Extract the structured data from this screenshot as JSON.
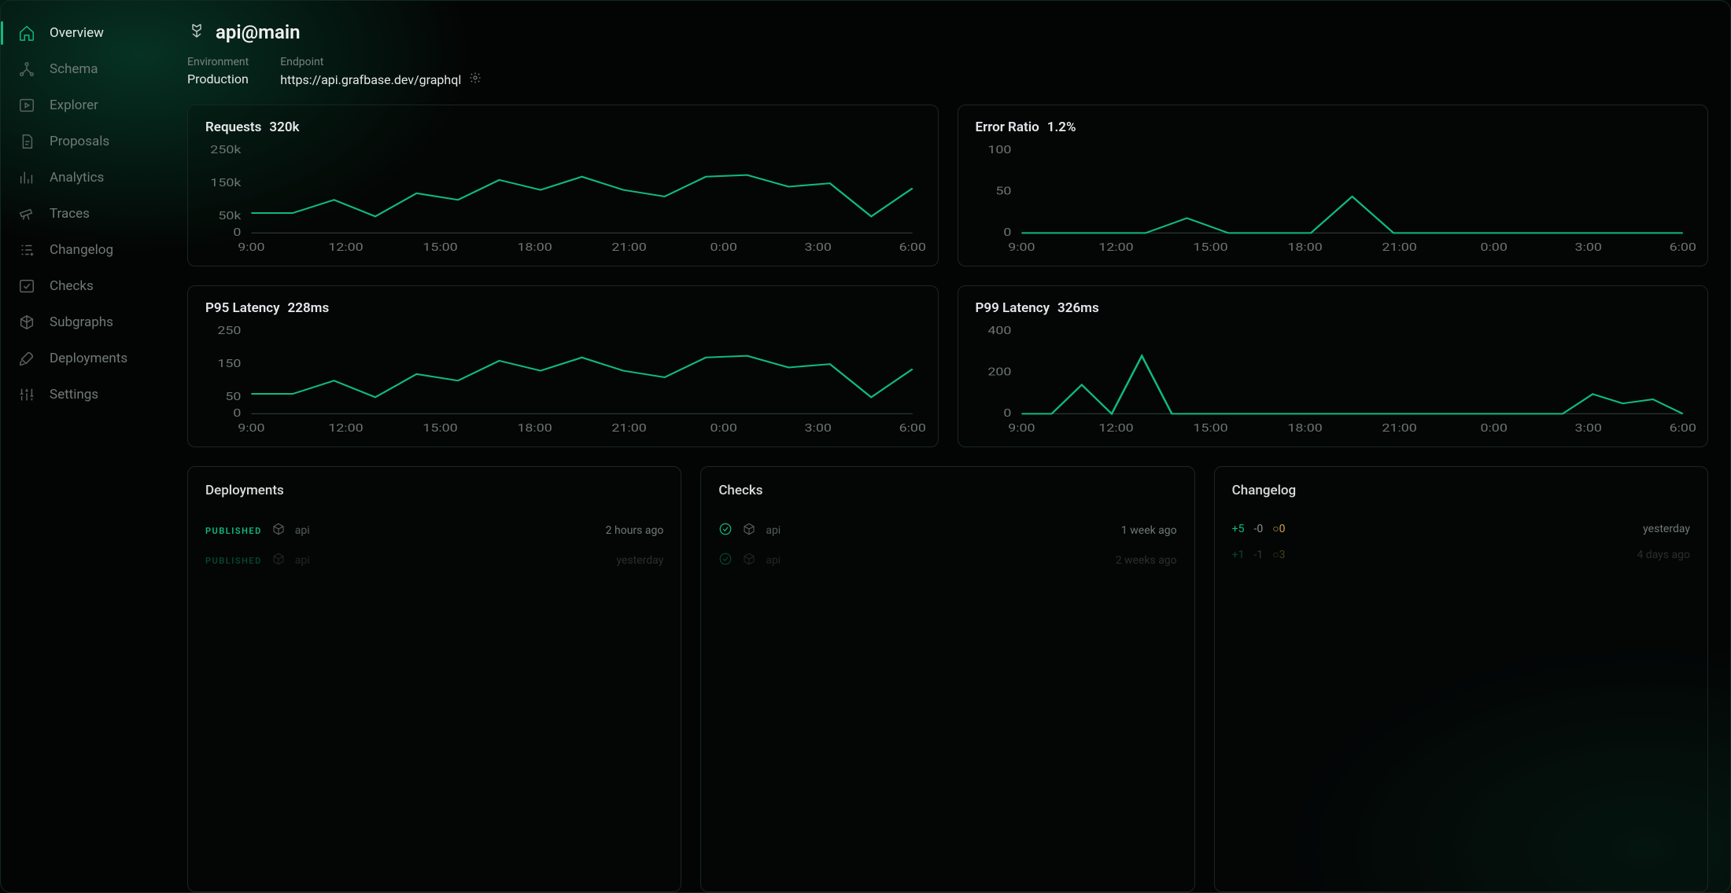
{
  "sidebar": {
    "items": [
      {
        "label": "Overview"
      },
      {
        "label": "Schema"
      },
      {
        "label": "Explorer"
      },
      {
        "label": "Proposals"
      },
      {
        "label": "Analytics"
      },
      {
        "label": "Traces"
      },
      {
        "label": "Changelog"
      },
      {
        "label": "Checks"
      },
      {
        "label": "Subgraphs"
      },
      {
        "label": "Deployments"
      },
      {
        "label": "Settings"
      }
    ]
  },
  "header": {
    "title": "api@main",
    "env_label": "Environment",
    "env_value": "Production",
    "endpoint_label": "Endpoint",
    "endpoint_value": "https://api.grafbase.dev/graphql"
  },
  "cards": {
    "requests": {
      "title": "Requests",
      "value": "320k"
    },
    "errors": {
      "title": "Error Ratio",
      "value": "1.2%"
    },
    "p95": {
      "title": "P95 Latency",
      "value": "228ms"
    },
    "p99": {
      "title": "P99 Latency",
      "value": "326ms"
    }
  },
  "bottom": {
    "deployments": {
      "title": "Deployments",
      "rows": [
        {
          "badge": "PUBLISHED",
          "name": "api",
          "time": "2 hours ago"
        },
        {
          "badge": "PUBLISHED",
          "name": "api",
          "time": "yesterday"
        }
      ]
    },
    "checks": {
      "title": "Checks",
      "rows": [
        {
          "name": "api",
          "time": "1 week ago"
        },
        {
          "name": "api",
          "time": "2 weeks ago"
        }
      ]
    },
    "changelog": {
      "title": "Changelog",
      "rows": [
        {
          "plus": "+5",
          "minus": "-0",
          "ring": "○0",
          "time": "yesterday"
        },
        {
          "plus": "+1",
          "minus": "-1",
          "ring": "○3",
          "time": "4 days ago"
        }
      ]
    }
  },
  "chart_data": [
    {
      "id": "requests",
      "type": "line",
      "title": "Requests 320k",
      "ylabel": "",
      "xlabel": "",
      "ylim": [
        0,
        250000
      ],
      "yticks": [
        0,
        50000,
        150000,
        250000
      ],
      "ytick_labels": [
        "0",
        "50k",
        "150k",
        "250k"
      ],
      "xticks": [
        "9:00",
        "12:00",
        "15:00",
        "18:00",
        "21:00",
        "0:00",
        "3:00",
        "6:00"
      ],
      "x": [
        0,
        1,
        2,
        3,
        4,
        5,
        6,
        7,
        8,
        9,
        10,
        11,
        12,
        13,
        14,
        15
      ],
      "values": [
        60000,
        60000,
        100000,
        50000,
        120000,
        100000,
        160000,
        130000,
        170000,
        130000,
        110000,
        170000,
        175000,
        140000,
        150000,
        50000,
        135000
      ]
    },
    {
      "id": "errors",
      "type": "line",
      "title": "Error Ratio 1.2%",
      "ylim": [
        0,
        100
      ],
      "yticks": [
        0,
        50,
        100
      ],
      "ytick_labels": [
        "0",
        "50",
        "100"
      ],
      "xticks": [
        "9:00",
        "12:00",
        "15:00",
        "18:00",
        "21:00",
        "0:00",
        "3:00",
        "6:00"
      ],
      "x": [
        0,
        1,
        2,
        3,
        4,
        5,
        6,
        7,
        8,
        9,
        10,
        11,
        12,
        13,
        14,
        15,
        16
      ],
      "values": [
        0,
        0,
        0,
        0,
        18,
        0,
        0,
        0,
        44,
        0,
        0,
        0,
        0,
        0,
        0,
        0,
        0
      ]
    },
    {
      "id": "p95",
      "type": "line",
      "title": "P95 Latency 228ms",
      "ylim": [
        0,
        250
      ],
      "yticks": [
        0,
        50,
        150,
        250
      ],
      "ytick_labels": [
        "0",
        "50",
        "150",
        "250"
      ],
      "xticks": [
        "9:00",
        "12:00",
        "15:00",
        "18:00",
        "21:00",
        "0:00",
        "3:00",
        "6:00"
      ],
      "x": [
        0,
        1,
        2,
        3,
        4,
        5,
        6,
        7,
        8,
        9,
        10,
        11,
        12,
        13,
        14,
        15
      ],
      "values": [
        60,
        60,
        100,
        50,
        120,
        100,
        160,
        130,
        170,
        130,
        110,
        170,
        175,
        140,
        150,
        50,
        135
      ]
    },
    {
      "id": "p99",
      "type": "line",
      "title": "P99 Latency 326ms",
      "ylim": [
        0,
        400
      ],
      "yticks": [
        0,
        200,
        400
      ],
      "ytick_labels": [
        "0",
        "200",
        "400"
      ],
      "xticks": [
        "9:00",
        "12:00",
        "15:00",
        "18:00",
        "21:00",
        "0:00",
        "3:00",
        "6:00"
      ],
      "x": [
        0,
        1,
        2,
        3,
        4,
        5,
        6,
        7,
        8,
        9,
        10,
        11,
        12,
        13,
        14,
        15,
        16,
        17,
        18,
        19,
        20,
        21,
        22
      ],
      "values": [
        0,
        0,
        140,
        0,
        280,
        0,
        0,
        0,
        0,
        0,
        0,
        0,
        0,
        0,
        0,
        0,
        0,
        0,
        0,
        95,
        50,
        70,
        0
      ]
    }
  ]
}
